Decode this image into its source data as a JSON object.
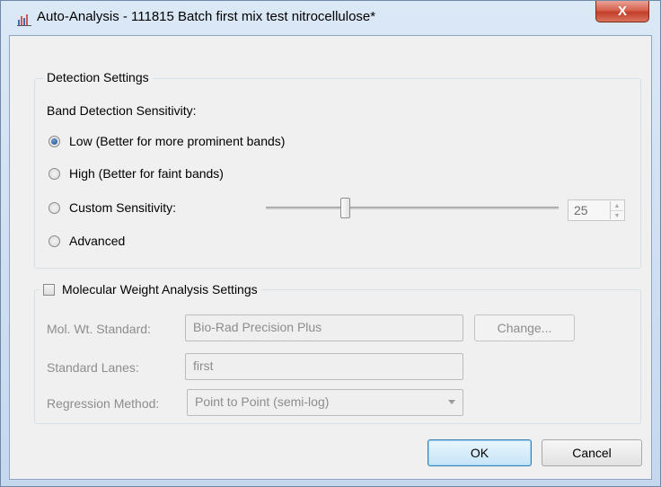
{
  "window": {
    "title": "Auto-Analysis - 111815 Batch first mix test nitrocellulose*",
    "close_glyph": "X"
  },
  "detection": {
    "legend": "Detection Settings",
    "sensitivity_label": "Band Detection Sensitivity:",
    "options": [
      {
        "label": "Low (Better for more prominent bands)",
        "selected": true
      },
      {
        "label": "High (Better for faint bands)",
        "selected": false
      },
      {
        "label": "Custom Sensitivity:",
        "selected": false
      },
      {
        "label": "Advanced",
        "selected": false
      }
    ],
    "custom_value": "25",
    "slider_fraction": 0.27
  },
  "mw": {
    "legend": "Molecular Weight Analysis Settings",
    "checked": false,
    "standard_label": "Mol. Wt. Standard:",
    "standard_value": "Bio-Rad Precision Plus",
    "change_label": "Change...",
    "lanes_label": "Standard Lanes:",
    "lanes_value": "first",
    "regression_label": "Regression Method:",
    "regression_value": "Point to Point (semi-log)"
  },
  "buttons": {
    "ok": "OK",
    "cancel": "Cancel"
  },
  "icons": {
    "app": "chart-bars-icon",
    "close": "close-icon",
    "spin_up": "chevron-up-icon",
    "spin_down": "chevron-down-icon",
    "dropdown": "dropdown-arrow-icon"
  },
  "colors": {
    "close_button": "#c23f28",
    "window_frame": "#c5d8ee",
    "dialog_bg": "#f0f0f0"
  }
}
